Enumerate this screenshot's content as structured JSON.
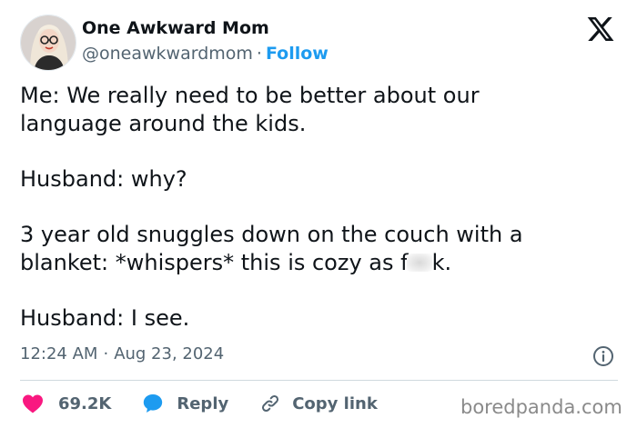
{
  "author": {
    "display_name": "One Awkward Mom",
    "handle": "@oneawkwardmom",
    "separator": "·",
    "follow_label": "Follow"
  },
  "tweet": {
    "lines": [
      "Me: We really need to be better about our",
      "language around the kids.",
      "Husband: why?",
      "3 year old snuggles down on the couch with a",
      "blanket: *whispers* this is cozy as f",
      "k.",
      "Husband: I see."
    ]
  },
  "meta": {
    "time": "12:24 AM",
    "separator": "·",
    "date": "Aug 23, 2024"
  },
  "actions": {
    "like_count": "69.2K",
    "reply_label": "Reply",
    "copy_link_label": "Copy link"
  },
  "watermark": "boredpanda.com",
  "icons": {
    "avatar": "avatar-photo",
    "brand": "x-logo-icon",
    "info": "info-icon",
    "like": "heart-icon",
    "reply": "speech-bubble-icon",
    "copy": "link-icon"
  },
  "colors": {
    "link_blue": "#1d9bf0",
    "like_red": "#f91880",
    "secondary_text": "#536471",
    "primary_text": "#0f1419"
  }
}
